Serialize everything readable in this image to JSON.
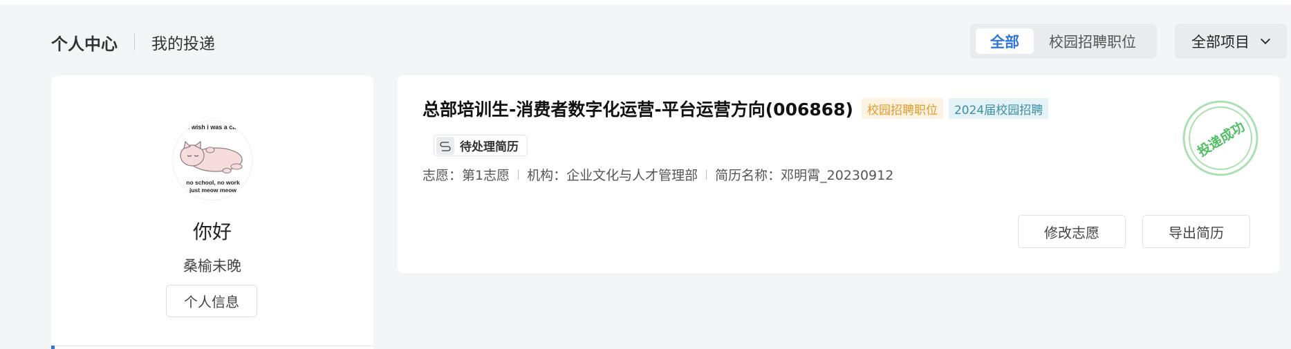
{
  "header": {
    "title": "个人中心",
    "subtitle": "我的投递"
  },
  "filter": {
    "tabs": [
      {
        "label": "全部",
        "active": true
      },
      {
        "label": "校园招聘职位",
        "active": false
      }
    ],
    "project_select": "全部项目"
  },
  "profile": {
    "avatar_caption_top": "i wish i was a cat",
    "avatar_caption_bottom_1": "no school, no work",
    "avatar_caption_bottom_2": "just meow meow",
    "greeting": "你好",
    "username": "桑榆未晚",
    "info_button": "个人信息"
  },
  "application": {
    "title": "总部培训生-消费者数字化运营-平台运营方向(006868)",
    "tags": [
      "校园招聘职位",
      "2024届校园招聘"
    ],
    "status": "待处理简历",
    "meta": {
      "preference": "志愿：第1志愿",
      "organization": "机构：企业文化与人才管理部",
      "resume": "简历名称：邓明霄_20230912"
    },
    "stamp_text": "投递成功",
    "buttons": {
      "modify": "修改志愿",
      "export": "导出简历"
    }
  },
  "colors": {
    "accent": "#2f74d6",
    "tag_orange": "#e29b2b",
    "tag_teal": "#3b8fa6",
    "stamp_green": "#5cc76d"
  }
}
